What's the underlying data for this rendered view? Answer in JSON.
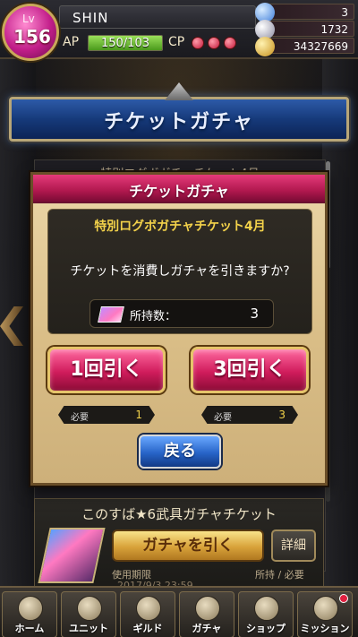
{
  "status": {
    "level_label": "Lv",
    "level": "156",
    "player_name": "SHIN",
    "ap_label": "AP",
    "ap_value": "150/103",
    "ap_fill": 1.0,
    "cp_label": "CP",
    "cp_count": 3,
    "resources": [
      {
        "name": "gem-icon",
        "value": "3",
        "color": "#6fb0ff"
      },
      {
        "name": "medal-icon",
        "value": "1732",
        "color": "#c8c8d8"
      },
      {
        "name": "coin-icon",
        "value": "34327669",
        "color": "#f2c84a"
      }
    ]
  },
  "banner": {
    "title": "チケットガチャ"
  },
  "background_list": {
    "top_text": "特別ログボガチャチケット4月",
    "card": {
      "title": "このすば★6武具ガチャチケット",
      "draw_button": "ガチャを引く",
      "detail_button": "詳細",
      "expiry_label": "使用期限",
      "owned_required_label": "所持 / 必要",
      "expiry_date": "2017/9/3 23:59"
    }
  },
  "dialog": {
    "title": "チケットガチャ",
    "ticket_name": "特別ログボガチャチケット4月",
    "question": "チケットを消費しガチャを引きますか?",
    "owned_label": "所持数：",
    "owned_value": "3",
    "draw_once": "1回引く",
    "draw_three": "3回引く",
    "required_label": "必要",
    "required_once": "1",
    "required_three": "3",
    "back": "戻る"
  },
  "nav": [
    {
      "label": "ホーム",
      "icon": "home-icon",
      "badge": false
    },
    {
      "label": "ユニット",
      "icon": "unit-icon",
      "badge": false
    },
    {
      "label": "ギルド",
      "icon": "guild-icon",
      "badge": false
    },
    {
      "label": "ガチャ",
      "icon": "gacha-icon",
      "badge": false
    },
    {
      "label": "ショップ",
      "icon": "shop-icon",
      "badge": false
    },
    {
      "label": "ミッション",
      "icon": "mission-icon",
      "badge": true
    }
  ]
}
